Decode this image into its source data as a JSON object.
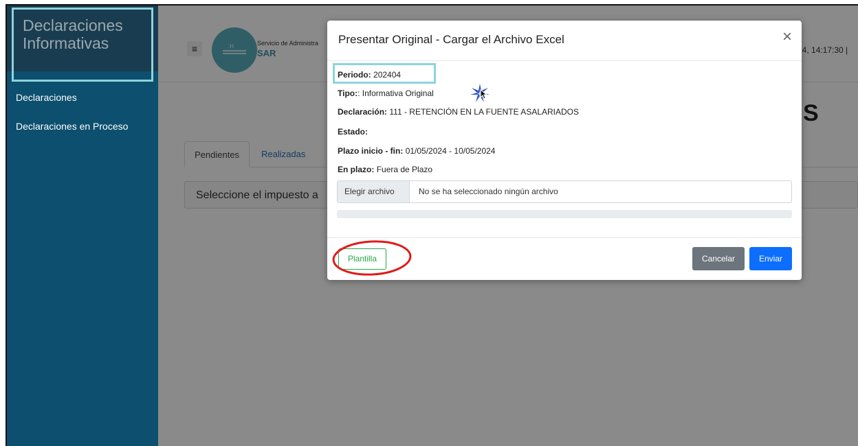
{
  "sidebar": {
    "title": "Declaraciones Informativas",
    "items": [
      {
        "label": "Declaraciones"
      },
      {
        "label": "Declaraciones en Proceso"
      }
    ]
  },
  "header": {
    "org_name": "Servicio de Administra",
    "org_abbr": "SAR",
    "datetime": "24, 14:17:30 |",
    "partial_heading": "S"
  },
  "tabs": [
    {
      "label": "Pendientes",
      "active": true
    },
    {
      "label": "Realizadas",
      "active": false
    }
  ],
  "select_prompt": "Seleccione el impuesto a",
  "modal": {
    "title": "Presentar Original - Cargar el Archivo Excel",
    "fields": {
      "periodo": {
        "label": "Periodo:",
        "value": "202404"
      },
      "tipo": {
        "label": "Tipo:",
        "value": ": Informativa Original"
      },
      "declaracion": {
        "label": "Declaración:",
        "value": "111 - RETENCIÓN EN LA FUENTE ASALARIADOS"
      },
      "estado": {
        "label": "Estado:",
        "value": ""
      },
      "plazo": {
        "label": "Plazo inicio - fin:",
        "value": "01/05/2024 - 10/05/2024"
      },
      "en_plazo": {
        "label": "En plazo:",
        "value": "Fuera de Plazo"
      }
    },
    "file_input": {
      "button_label": "Elegir archivo",
      "status": "No se ha seleccionado ningún archivo"
    },
    "progress": 0,
    "buttons": {
      "plantilla": "Plantilla",
      "cancel": "Cancelar",
      "send": "Enviar"
    }
  },
  "colors": {
    "sidebar": "#0d4f6e",
    "accent_box": "#8fd3dc",
    "primary": "#0d6efd",
    "secondary": "#6c757d",
    "success": "#28a745",
    "annotation": "#e01a1a"
  }
}
